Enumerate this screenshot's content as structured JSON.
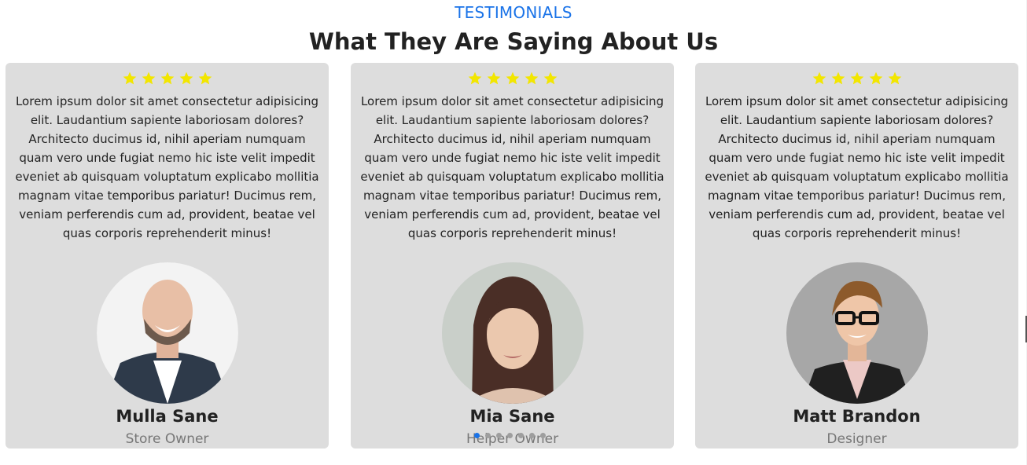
{
  "section": {
    "label": "TESTIMONIALS",
    "title": "What They Are Saying About Us"
  },
  "colors": {
    "accent": "#1a73e8",
    "star": "#f2e600",
    "card_bg": "#dddddd"
  },
  "testimonials": [
    {
      "stars": 5,
      "text": "Lorem ipsum dolor sit amet consectetur adipisicing elit. Laudantium sapiente laboriosam dolores? Architecto ducimus id, nihil aperiam numquam quam vero unde fugiat nemo hic iste velit impedit eveniet ab quisquam voluptatum explicabo mollitia magnam vitae temporibus pariatur! Ducimus rem, veniam perferendis cum ad, provident, beatae vel quas corporis reprehenderit minus!",
      "name": "Mulla Sane",
      "role": "Store Owner",
      "avatar_icon": "laughing-bearded-man-photo"
    },
    {
      "stars": 5,
      "text": "Lorem ipsum dolor sit amet consectetur adipisicing elit. Laudantium sapiente laboriosam dolores? Architecto ducimus id, nihil aperiam numquam quam vero unde fugiat nemo hic iste velit impedit eveniet ab quisquam voluptatum explicabo mollitia magnam vitae temporibus pariatur! Ducimus rem, veniam perferendis cum ad, provident, beatae vel quas corporis reprehenderit minus!",
      "name": "Mia Sane",
      "role": "Helper Owner",
      "avatar_icon": "smiling-woman-photo"
    },
    {
      "stars": 5,
      "text": "Lorem ipsum dolor sit amet consectetur adipisicing elit. Laudantium sapiente laboriosam dolores? Architecto ducimus id, nihil aperiam numquam quam vero unde fugiat nemo hic iste velit impedit eveniet ab quisquam voluptatum explicabo mollitia magnam vitae temporibus pariatur! Ducimus rem, veniam perferendis cum ad, provident, beatae vel quas corporis reprehenderit minus!",
      "name": "Matt Brandon",
      "role": "Designer",
      "avatar_icon": "woman-with-glasses-photo"
    }
  ],
  "carousel": {
    "page_count": 7,
    "active_index": 0
  }
}
